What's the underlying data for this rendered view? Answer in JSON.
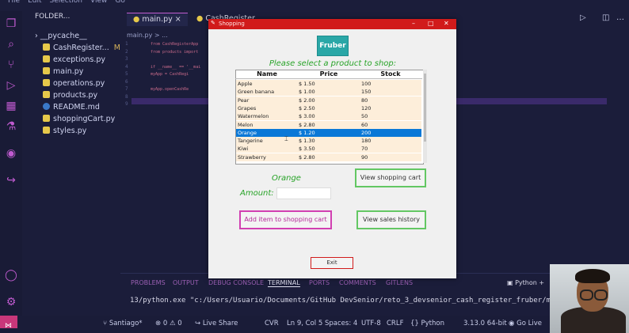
{
  "vscode": {
    "menu": [
      "File",
      "Edit",
      "Selection",
      "View",
      "Go"
    ],
    "explorer_title": "FOLDER...",
    "files": [
      {
        "name": "__pycache__",
        "kind": "folder"
      },
      {
        "name": "CashRegister...",
        "kind": "py",
        "status": "M"
      },
      {
        "name": "exceptions.py",
        "kind": "py"
      },
      {
        "name": "main.py",
        "kind": "py"
      },
      {
        "name": "operations.py",
        "kind": "py"
      },
      {
        "name": "products.py",
        "kind": "py"
      },
      {
        "name": "README.md",
        "kind": "info"
      },
      {
        "name": "shoppingCart.py",
        "kind": "py"
      },
      {
        "name": "styles.py",
        "kind": "py"
      }
    ],
    "tabs": [
      "main.py",
      "CashRegister"
    ],
    "breadcrumb": "main.py > ...",
    "line_numbers": [
      "1",
      "2",
      "3",
      "4",
      "5",
      "6",
      "7",
      "8",
      "9"
    ],
    "code_lines": [
      "from CashRegisterApp",
      "from products import",
      "",
      "if __name__ == '__mai",
      "    myApp = CashRegi",
      "",
      "    myApp.openCashRe",
      "",
      ""
    ],
    "panel_tabs": [
      "PROBLEMS",
      "OUTPUT",
      "DEBUG CONSOLE",
      "TERMINAL",
      "PORTS",
      "COMMENTS",
      "GITLENS"
    ],
    "active_panel_tab": "TERMINAL",
    "terminal_label": "Python",
    "terminal_text": "13/python.exe \"c:/Users/Usuario/Documents/GitHub DevSenior/reto_3_devsenior_cash_register_fruber/main.py\"",
    "status": {
      "branch": "Santiago*",
      "errors": "0",
      "warnings": "0",
      "live_share": "Live Share",
      "mode": "CVR",
      "position": "Ln 9, Col 5",
      "spaces": "Spaces: 4",
      "encoding": "UTF-8",
      "eol": "CRLF",
      "language": "Python",
      "interpreter": "3.13.0 64-bit",
      "go_live": "Go Live"
    },
    "colors": {
      "accent": "#c05bd0",
      "background": "#1b1d3a"
    }
  },
  "app": {
    "window_title": "Shopping",
    "logo_text": "Fruber",
    "prompt": "Please select a product to shop:",
    "columns": [
      "Name",
      "Price",
      "Stock"
    ],
    "products": [
      {
        "name": "Apple",
        "price": "$ 1.50",
        "stock": "100"
      },
      {
        "name": "Green banana",
        "price": "$ 1.00",
        "stock": "150"
      },
      {
        "name": "Pear",
        "price": "$ 2.00",
        "stock": "80"
      },
      {
        "name": "Grapes",
        "price": "$ 2.50",
        "stock": "120"
      },
      {
        "name": "Watermelon",
        "price": "$ 3.00",
        "stock": "50"
      },
      {
        "name": "Melon",
        "price": "$ 2.80",
        "stock": "60"
      },
      {
        "name": "Orange",
        "price": "$ 1.20",
        "stock": "200"
      },
      {
        "name": "Tangerine",
        "price": "$ 1.30",
        "stock": "180"
      },
      {
        "name": "Kiwi",
        "price": "$ 3.50",
        "stock": "70"
      },
      {
        "name": "Strawberry",
        "price": "$ 2.80",
        "stock": "90"
      }
    ],
    "selected_index": 6,
    "selected_product": "Orange",
    "amount_label": "Amount:",
    "amount_value": "",
    "buttons": {
      "view_cart": "View shopping cart",
      "add_item": "Add item to shopping cart",
      "view_history": "View sales history",
      "exit": "Exit"
    },
    "colors": {
      "title_bar": "#d11b1b",
      "logo": "#2aa7a7",
      "prompt": "#27a327",
      "row": "#fdeeda",
      "selected_row": "#0a78d7",
      "add_border": "#d13fb1",
      "green_border": "#63c763"
    }
  }
}
